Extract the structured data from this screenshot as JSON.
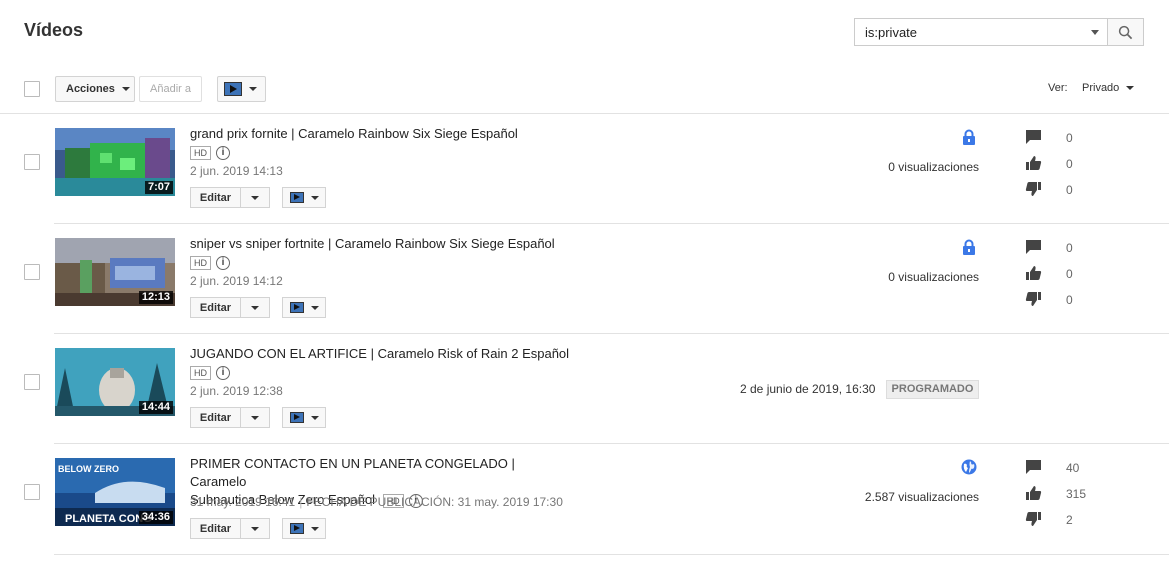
{
  "page": {
    "title": "Vídeos"
  },
  "search": {
    "value": "is:private"
  },
  "toolbar": {
    "actions_label": "Acciones",
    "add_to_label": "Añadir a"
  },
  "view": {
    "label": "Ver:",
    "selected": "Privado"
  },
  "videos": [
    {
      "title": "grand prix fornite | Caramelo Rainbow Six Siege Español",
      "hd": "HD",
      "duration": "7:07",
      "date": "2 jun. 2019 14:13",
      "privacy_icon": "lock-icon",
      "views": "0 visualizaciones",
      "comments": "0",
      "likes": "0",
      "dislikes": "0",
      "edit_label": "Editar"
    },
    {
      "title": "sniper vs sniper fortnite | Caramelo Rainbow Six Siege Español",
      "hd": "HD",
      "duration": "12:13",
      "date": "2 jun. 2019 14:12",
      "privacy_icon": "lock-icon",
      "views": "0 visualizaciones",
      "comments": "0",
      "likes": "0",
      "dislikes": "0",
      "edit_label": "Editar"
    },
    {
      "title": "JUGANDO CON EL ARTIFICE | Caramelo Risk of Rain 2 Español",
      "hd": "HD",
      "duration": "14:44",
      "date": "2 jun. 2019 12:38",
      "scheduled": "2 de junio de 2019, 16:30",
      "badge": "PROGRAMADO",
      "edit_label": "Editar"
    },
    {
      "title_line1": "PRIMER CONTACTO EN UN PLANETA CONGELADO | Caramelo",
      "title_line2": "Subnautica Below Zero Español",
      "hd": "HD",
      "duration": "34:36",
      "thumb_text_top": "BELOW ZERO",
      "thumb_text_bottom": "PLANETA CONG",
      "date": "31 may. 2019 16:41",
      "published": "FECHA DE PUBLICACIÓN: 31 may. 2019 17:30",
      "privacy_icon": "globe-icon",
      "views": "2.587 visualizaciones",
      "comments": "40",
      "likes": "315",
      "dislikes": "2",
      "edit_label": "Editar"
    }
  ],
  "colors": {
    "accent": "#3d73b8",
    "lock": "#3b78e7",
    "globe": "#3b78e7"
  }
}
